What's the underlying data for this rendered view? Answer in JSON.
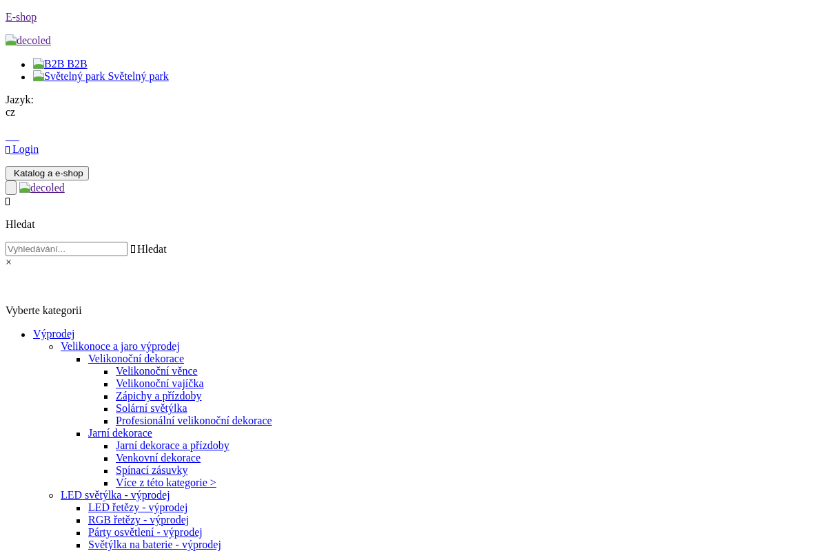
{
  "top_link": {
    "label": "E-shop",
    "visited": true
  },
  "logo": {
    "alt": "decoled",
    "visited": true
  },
  "portal_links": [
    {
      "alt": "B2B",
      "label": "B2B",
      "visited": false
    },
    {
      "alt": "Světelný park",
      "label": "Světelný park",
      "visited": false
    }
  ],
  "language": {
    "label": "Jazyk:",
    "value": "cz"
  },
  "login": {
    "label": "Login",
    "visited": false
  },
  "catalog_button": {
    "label": "Katalog a e-shop"
  },
  "mobile_logo": {
    "alt": "decoled",
    "visited": true
  },
  "search": {
    "heading": "Hledat",
    "placeholder": "Vyhledávání...",
    "submit_label": "Hledat",
    "close": "×"
  },
  "categories": {
    "title": "Vyberte kategorii",
    "items": [
      {
        "label": "Výprodej",
        "children": [
          {
            "label": "Velikonoce a jaro výprodej",
            "children": [
              {
                "label": "Velikonoční dekorace",
                "children": [
                  {
                    "label": "Velikonoční věnce"
                  },
                  {
                    "label": "Velikonoční vajíčka"
                  },
                  {
                    "label": "Zápichy a přízdoby"
                  },
                  {
                    "label": "Solární světýlka"
                  },
                  {
                    "label": "Profesionální velikonoční dekorace"
                  }
                ]
              },
              {
                "label": "Jarní dekorace",
                "children": [
                  {
                    "label": "Jarní dekorace a přízdoby"
                  },
                  {
                    "label": "Venkovní dekorace"
                  },
                  {
                    "label": "Spínací zásuvky"
                  },
                  {
                    "label": "Více z této kategorie >"
                  }
                ]
              }
            ]
          },
          {
            "label": "LED světýlka - výprodej",
            "children": [
              {
                "label": "LED řetězy - výprodej"
              },
              {
                "label": "RGB řetězy - výprodej"
              },
              {
                "label": "Párty osvětlení - výprodej"
              },
              {
                "label": "Světýlka na baterie - výprodej"
              }
            ]
          }
        ]
      }
    ]
  }
}
